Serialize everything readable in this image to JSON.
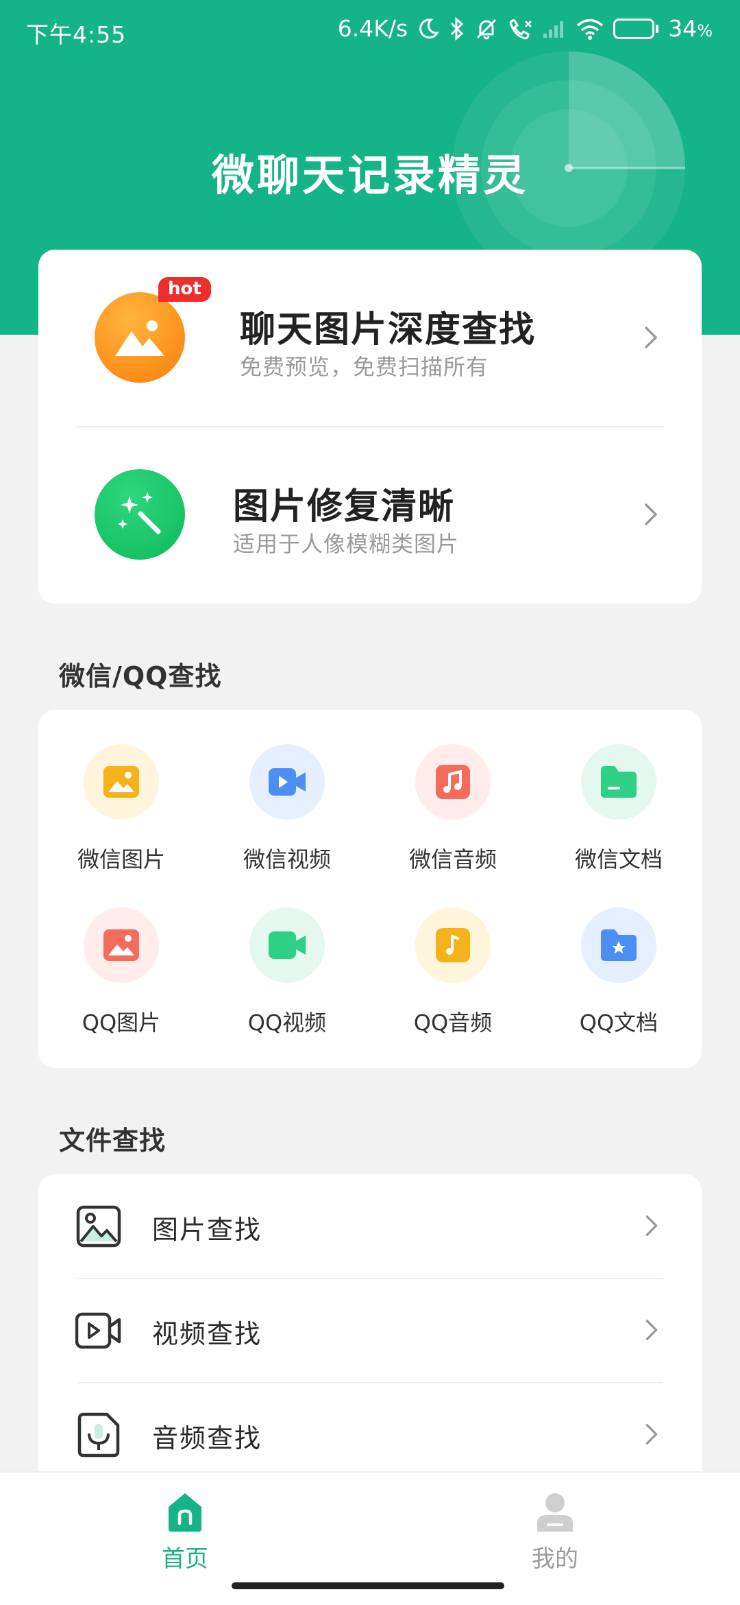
{
  "status_bar": {
    "time": "下午4:55",
    "net_speed": "6.4K/s",
    "battery": "34",
    "battery_unit": "%",
    "battery_level": 0.34
  },
  "header": {
    "title": "微聊天记录精灵"
  },
  "features": [
    {
      "title": "聊天图片深度查找",
      "subtitle": "免费预览，免费扫描所有",
      "badge": "hot",
      "icon": "image-landscape-icon",
      "color": "#fb8c12"
    },
    {
      "title": "图片修复清晰",
      "subtitle": "适用于人像模糊类图片",
      "icon": "magic-wand-icon",
      "color": "#17c163"
    }
  ],
  "wx_qq_section": {
    "title": "微信/QQ查找",
    "items": [
      {
        "label": "微信图片",
        "icon": "image-icon",
        "color": "#f5b21a",
        "bg": "#fff4dc"
      },
      {
        "label": "微信视频",
        "icon": "video-icon",
        "color": "#4d8ef5",
        "bg": "#e6efff"
      },
      {
        "label": "微信音频",
        "icon": "music-icon",
        "color": "#f36c5c",
        "bg": "#ffeceb"
      },
      {
        "label": "微信文档",
        "icon": "folder-icon",
        "color": "#2fcf86",
        "bg": "#e4f8ef"
      },
      {
        "label": "QQ图片",
        "icon": "image-icon",
        "color": "#f36c5c",
        "bg": "#ffeceb"
      },
      {
        "label": "QQ视频",
        "icon": "video-camera-icon",
        "color": "#2fcf86",
        "bg": "#e4f8ef"
      },
      {
        "label": "QQ音频",
        "icon": "music-icon",
        "color": "#f5b21a",
        "bg": "#fff4dc"
      },
      {
        "label": "QQ文档",
        "icon": "star-folder-icon",
        "color": "#4d8ef5",
        "bg": "#e6efff"
      }
    ]
  },
  "file_section": {
    "title": "文件查找",
    "items": [
      {
        "label": "图片查找",
        "icon": "image-outline-icon"
      },
      {
        "label": "视频查找",
        "icon": "video-outline-icon"
      },
      {
        "label": "音频查找",
        "icon": "audio-outline-icon"
      }
    ]
  },
  "tabbar": {
    "home": "首页",
    "mine": "我的"
  },
  "colors": {
    "brand": "#15b388",
    "hot": "#ee2d2d"
  }
}
